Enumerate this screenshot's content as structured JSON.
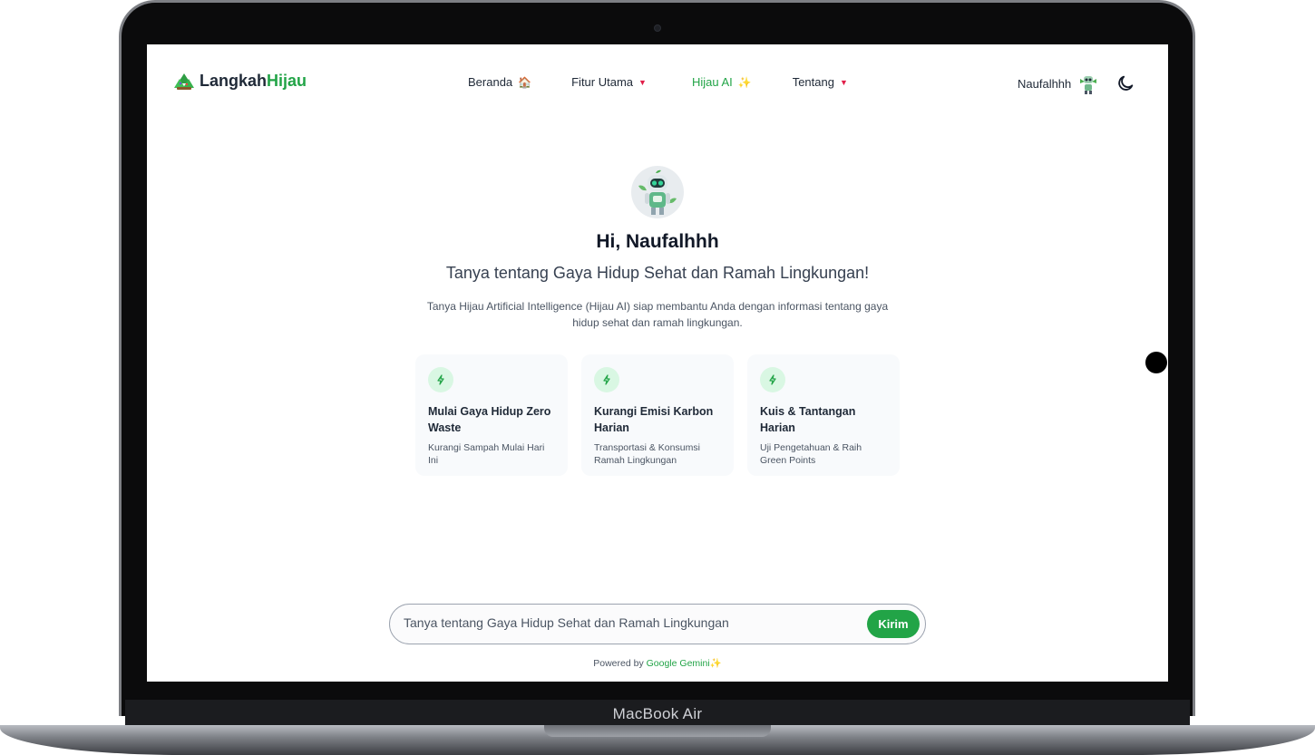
{
  "device": {
    "label": "MacBook Air"
  },
  "nav": {
    "logo_part1": "Langkah",
    "logo_part2": "Hijau",
    "items": [
      {
        "label": "Beranda",
        "icon": "🏠"
      },
      {
        "label": "Fitur Utama",
        "caret": "▼"
      },
      {
        "label": "Hijau AI",
        "icon": "✨"
      },
      {
        "label": "Tentang",
        "caret": "▼"
      }
    ],
    "username": "Naufalhhh"
  },
  "hero": {
    "greeting": "Hi, Naufalhhh",
    "subtitle": "Tanya tentang Gaya Hidup Sehat dan Ramah Lingkungan!",
    "description": "Tanya Hijau Artificial Intelligence (Hijau AI) siap membantu Anda dengan informasi tentang gaya hidup sehat dan ramah lingkungan."
  },
  "cards": [
    {
      "title": "Mulai Gaya Hidup Zero Waste",
      "subtitle": "Kurangi Sampah Mulai Hari Ini"
    },
    {
      "title": "Kurangi Emisi Karbon Harian",
      "subtitle": "Transportasi & Konsumsi Ramah Lingkungan"
    },
    {
      "title": "Kuis & Tantangan Harian",
      "subtitle": "Uji Pengetahuan & Raih Green Points"
    }
  ],
  "chat": {
    "placeholder": "Tanya tentang Gaya Hidup Sehat dan Ramah Lingkungan",
    "send_label": "Kirim"
  },
  "footer": {
    "powered_prefix": "Powered by",
    "powered_brand": "Google Gemini",
    "powered_icon": "✨"
  },
  "colors": {
    "accent": "#22a447",
    "caret": "#e11d48",
    "card_bg": "#f8fafc",
    "icon_bg": "#d9f7e3"
  }
}
